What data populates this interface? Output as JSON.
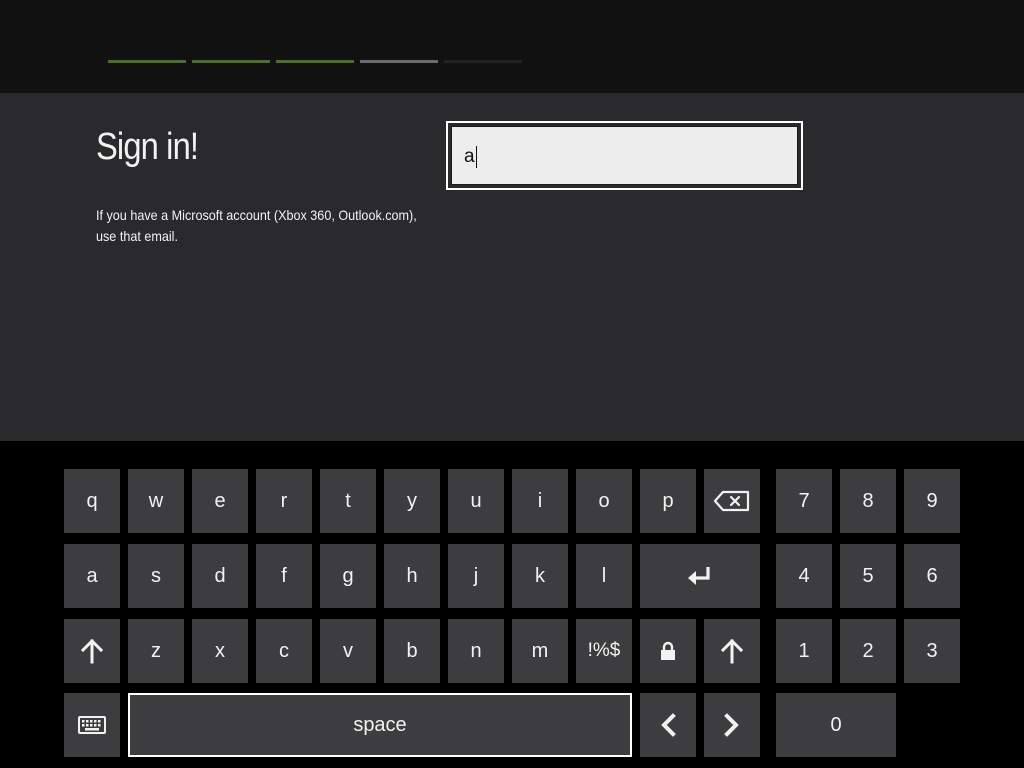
{
  "theme": {
    "accent": "#5b8a2a",
    "progress_done": "#4f7a2a",
    "progress_current": "#6e6e72",
    "progress_pending": "#2a2a2c",
    "key_bg": "#3d3d3f",
    "panel_bg": "#2a292c"
  },
  "progress": {
    "total_steps": 5,
    "completed_steps": 3,
    "current_step": 4
  },
  "signin": {
    "title": "Sign in!",
    "description": "If you have a Microsoft account (Xbox 360, Outlook.com), use that email.",
    "email_value": "a"
  },
  "keyboard": {
    "row1": [
      "q",
      "w",
      "e",
      "r",
      "t",
      "y",
      "u",
      "i",
      "o",
      "p"
    ],
    "row2": [
      "a",
      "s",
      "d",
      "f",
      "g",
      "h",
      "j",
      "k",
      "l"
    ],
    "row3": [
      "z",
      "x",
      "c",
      "v",
      "b",
      "n",
      "m"
    ],
    "symbols_label": "!%$",
    "space_label": "space",
    "numpad": [
      "7",
      "8",
      "9",
      "4",
      "5",
      "6",
      "1",
      "2",
      "3",
      "0"
    ],
    "icons": {
      "backspace": "backspace-icon",
      "enter": "enter-icon",
      "shift": "shift-arrow-up-icon",
      "caps_lock": "lock-icon",
      "keyboard_layout": "keyboard-icon",
      "cursor_left": "chevron-left-icon",
      "cursor_right": "chevron-right-icon"
    }
  }
}
